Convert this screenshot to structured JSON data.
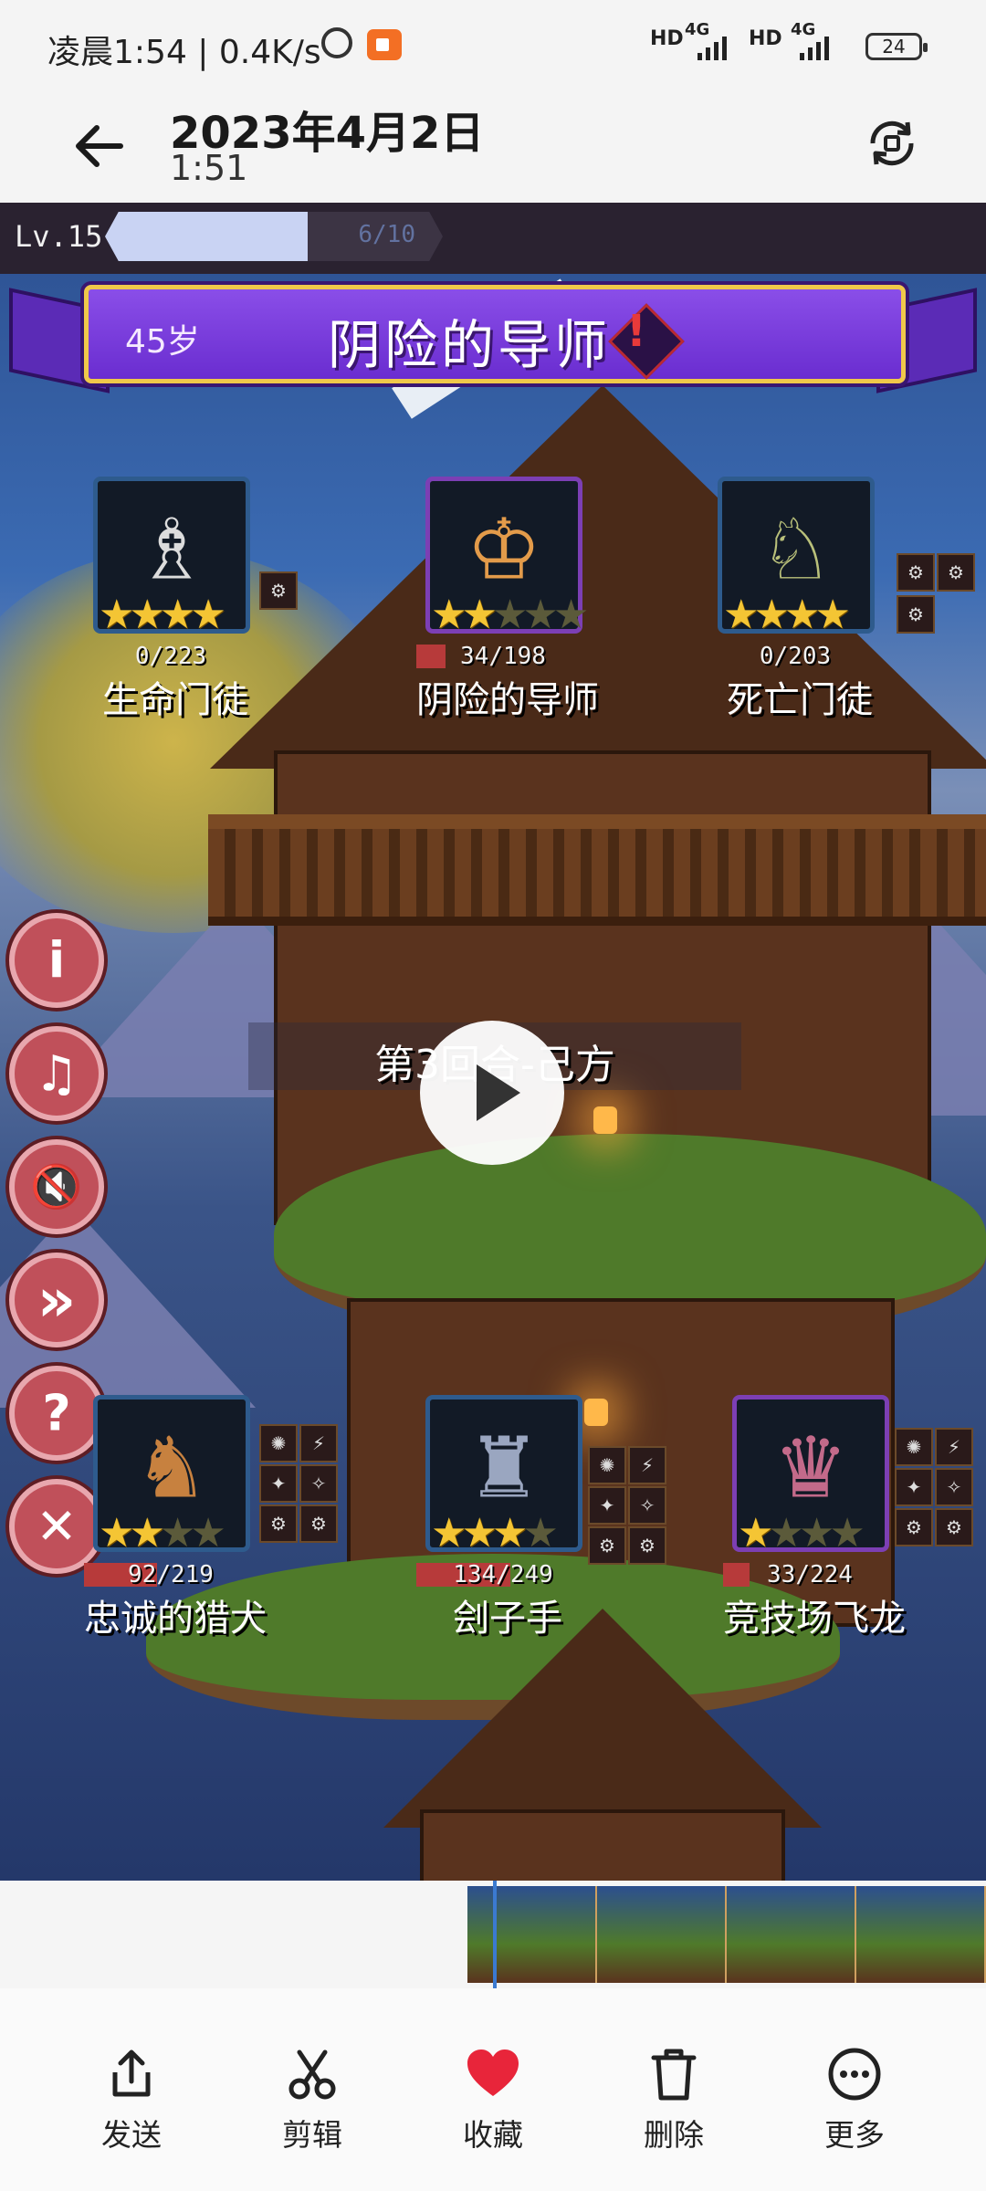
{
  "status_bar": {
    "time_speed": "凌晨1:54 | 0.4K/s",
    "network_1": "HD",
    "network_1_gen": "4G",
    "network_2": "HD",
    "network_2_gen": "4G",
    "battery": "24"
  },
  "header": {
    "date": "2023年4月2日",
    "time": "1:51"
  },
  "game": {
    "level_label": "Lv.15",
    "xp_text": "6/10",
    "xp_fraction": 0.6,
    "banner_age": "45岁",
    "banner_title": "阴险的导师",
    "banner_alert": "!",
    "round_text": "第3回合-己方",
    "enemies": [
      {
        "name": "生命门徒",
        "hp": "0/223",
        "hp_fraction": 0.0,
        "stars": 4,
        "max_stars": 4,
        "fig": "♗"
      },
      {
        "name": "阴险的导师",
        "hp": "34/198",
        "hp_fraction": 0.17,
        "stars": 2,
        "max_stars": 5,
        "fig": "♔"
      },
      {
        "name": "死亡门徒",
        "hp": "0/203",
        "hp_fraction": 0.0,
        "stars": 4,
        "max_stars": 4,
        "fig": "♘"
      }
    ],
    "allies": [
      {
        "name": "忠诚的猎犬",
        "hp": "92/219",
        "hp_fraction": 0.42,
        "stars": 2,
        "max_stars": 4,
        "fig": "♞"
      },
      {
        "name": "刽子手",
        "hp": "134/249",
        "hp_fraction": 0.54,
        "stars": 3,
        "max_stars": 4,
        "fig": "♜"
      },
      {
        "name": "竞技场飞龙",
        "hp": "33/224",
        "hp_fraction": 0.15,
        "stars": 1,
        "max_stars": 4,
        "fig": "♛"
      }
    ],
    "side_buttons": {
      "info": "i",
      "music_off": "♫",
      "sound_off": "🔇",
      "fast_forward": "»",
      "help": "?",
      "close": "✕"
    }
  },
  "toolbar": {
    "send": "发送",
    "edit": "剪辑",
    "favorite": "收藏",
    "delete": "删除",
    "more": "更多"
  },
  "colors": {
    "favorite_heart": "#e8253a",
    "banner_purple": "#7b3fe0",
    "banner_gold": "#f0c84a"
  }
}
